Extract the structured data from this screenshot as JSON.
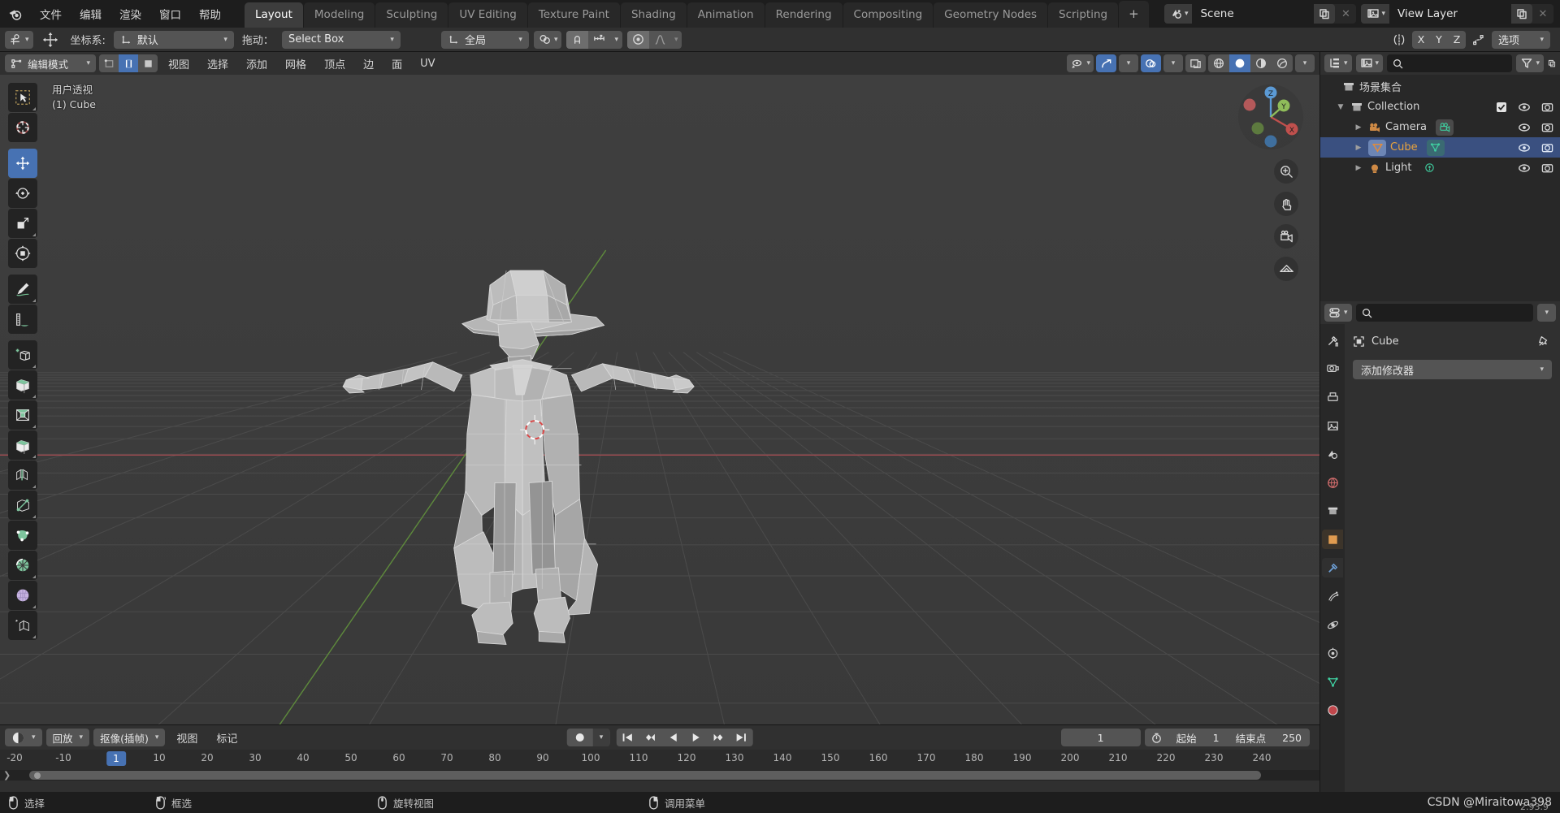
{
  "app": {
    "title": "Blender",
    "menus": [
      "文件",
      "编辑",
      "渲染",
      "窗口",
      "帮助"
    ],
    "workspaces": [
      {
        "label": "Layout",
        "active": true
      },
      {
        "label": "Modeling",
        "active": false
      },
      {
        "label": "Sculpting",
        "active": false
      },
      {
        "label": "UV Editing",
        "active": false
      },
      {
        "label": "Texture Paint",
        "active": false
      },
      {
        "label": "Shading",
        "active": false
      },
      {
        "label": "Animation",
        "active": false
      },
      {
        "label": "Rendering",
        "active": false
      },
      {
        "label": "Compositing",
        "active": false
      },
      {
        "label": "Geometry Nodes",
        "active": false
      },
      {
        "label": "Scripting",
        "active": false
      }
    ],
    "add_workspace_label": "+",
    "scene_name": "Scene",
    "view_layer_name": "View Layer"
  },
  "tool_settings": {
    "transform_orientation_label": "坐标系:",
    "transform_orientation_value": "默认",
    "drag_label": "拖动：",
    "drag_value": "Select Box",
    "snap_space_value": "全局",
    "proportional_axis": [
      "X",
      "Y",
      "Z"
    ],
    "options_label": "选项"
  },
  "viewport_header": {
    "mode": "编辑模式",
    "menus": [
      "视图",
      "选择",
      "添加",
      "网格",
      "顶点",
      "边",
      "面",
      "UV"
    ]
  },
  "viewport": {
    "overlay_line1": "用户透视",
    "overlay_line2": "(1) Cube"
  },
  "outliner": {
    "scene_collection_label": "场景集合",
    "rows": [
      {
        "label": "Collection",
        "type": "collection",
        "indent": 1,
        "selected": false,
        "checkbox": true
      },
      {
        "label": "Camera",
        "type": "camera",
        "indent": 2,
        "selected": false,
        "checkbox": false
      },
      {
        "label": "Cube",
        "type": "mesh",
        "indent": 2,
        "selected": true,
        "checkbox": false
      },
      {
        "label": "Light",
        "type": "light",
        "indent": 2,
        "selected": false,
        "checkbox": false
      }
    ]
  },
  "properties": {
    "breadcrumb_object": "Cube",
    "add_modifier_label": "添加修改器"
  },
  "timeline": {
    "playback_label": "回放",
    "keying_label": "抠像(插帧)",
    "view_label": "视图",
    "marker_label": "标记",
    "current_frame": "1",
    "start_label": "起始",
    "start_value": "1",
    "end_label": "结束点",
    "end_value": "250",
    "ticks": [
      "-20",
      "-10",
      "10",
      "20",
      "30",
      "40",
      "50",
      "60",
      "70",
      "80",
      "90",
      "100",
      "110",
      "120",
      "130",
      "140",
      "150",
      "160",
      "170",
      "180",
      "190",
      "200",
      "210",
      "220",
      "230",
      "240"
    ],
    "playhead_label": "1"
  },
  "statusbar": {
    "items": [
      {
        "icon": "mouse-left-icon",
        "label": "选择"
      },
      {
        "icon": "mouse-left-drag-icon",
        "label": "框选"
      },
      {
        "icon": "mouse-middle-icon",
        "label": "旋转视图"
      },
      {
        "icon": "mouse-right-icon",
        "label": "调用菜单"
      }
    ],
    "watermark": "CSDN @Miraitowa398",
    "version": "2.93.9"
  },
  "colors": {
    "accent_blue": "#4772b3",
    "header_bg": "#303030",
    "viewport_bg": "#3b3b3b",
    "panel_bg": "#282828",
    "x_axis_red": "#cf4a4a",
    "y_axis_green": "#7ba64d",
    "cube_orange": "#e09b50"
  }
}
